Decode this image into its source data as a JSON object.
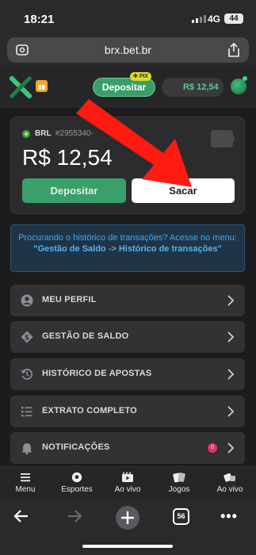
{
  "status_bar": {
    "time": "18:21",
    "network": "4G",
    "battery": "44"
  },
  "browser": {
    "url": "brx.bet.br",
    "tab_count": "56"
  },
  "header": {
    "deposit_label": "Depositar",
    "pix_badge": "PIX",
    "balance": "R$ 12,54"
  },
  "wallet": {
    "currency": "BRL",
    "account_id": "#2955340-",
    "balance": "R$ 12,54",
    "deposit_label": "Depositar",
    "withdraw_label": "Sacar"
  },
  "info": {
    "text": "Procurando o histórico de transações? Acesse no menu: ",
    "highlight": "\"Gestão de Saldo -> Histórico de transações\""
  },
  "menu": {
    "items": [
      {
        "label": "MEU PERFIL",
        "icon": "user-icon"
      },
      {
        "label": "GESTÃO DE SALDO",
        "icon": "dollar-icon"
      },
      {
        "label": "HISTÓRICO DE APOSTAS",
        "icon": "history-icon"
      },
      {
        "label": "EXTRATO COMPLETO",
        "icon": "list-icon"
      },
      {
        "label": "NOTIFICAÇÕES",
        "icon": "bell-icon",
        "badge": "0"
      }
    ]
  },
  "bottom_nav": {
    "items": [
      {
        "label": "Menu",
        "icon": "hamburger-icon"
      },
      {
        "label": "Esportes",
        "icon": "soccer-ball-icon"
      },
      {
        "label": "Ao vivo",
        "icon": "video-icon"
      },
      {
        "label": "Jogos",
        "icon": "cards-icon"
      },
      {
        "label": "Ao vivo",
        "icon": "live-casino-icon"
      }
    ]
  },
  "colors": {
    "accent_green": "#39a06b",
    "balance_green": "#5fc88e",
    "info_blue": "#4ba3e3",
    "annotation_red": "#ff1a12"
  }
}
